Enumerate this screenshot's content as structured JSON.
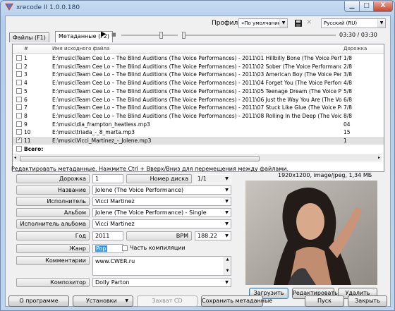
{
  "window": {
    "title": "xrecode II 1.0.0.180",
    "minimize_glyph": "▁",
    "maximize_glyph": "□",
    "close_glyph": "X"
  },
  "toolbar": {
    "profile_label": "Профиль",
    "profile_value": "«По умолчанию»",
    "save_icon": "floppy-disk-icon",
    "delete_icon": "close-x-icon",
    "language_value": "Русский (RU)",
    "tab_files": "Файлы (F1)",
    "tab_metadata": "Метаданные (F2)",
    "play_glyph": "▶",
    "stop_glyph": "■",
    "time": "03:30 / 03:30"
  },
  "list": {
    "col_number": "#",
    "col_filename": "Имя исходного файла",
    "col_track": "Дорожка",
    "rows": [
      {
        "num": "1",
        "file": "E:\\music\\Team Cee Lo – The Blind Auditions (The Voice Performances) - 2011\\01 Hillbilly Bone (The Voice Perform.m4a",
        "track": "1/8",
        "checked": false
      },
      {
        "num": "2",
        "file": "E:\\music\\Team Cee Lo – The Blind Auditions (The Voice Performances) - 2011\\02 Sober (The Voice Performance).m4a",
        "track": "2/8",
        "checked": false
      },
      {
        "num": "3",
        "file": "E:\\music\\Team Cee Lo – The Blind Auditions (The Voice Performances) - 2011\\03 American Boy (The Voice Performanc.m4a",
        "track": "3/8",
        "checked": false
      },
      {
        "num": "4",
        "file": "E:\\music\\Team Cee Lo – The Blind Auditions (The Voice Performances) - 2011\\04 Forget You (The Voice Performance).m4a",
        "track": "4/8",
        "checked": false
      },
      {
        "num": "5",
        "file": "E:\\music\\Team Cee Lo – The Blind Auditions (The Voice Performances) - 2011\\05 Teenage Dream (The Voice Performa.m4a",
        "track": "5/8",
        "checked": false
      },
      {
        "num": "6",
        "file": "E:\\music\\Team Cee Lo – The Blind Auditions (The Voice Performances) - 2011\\06 Just the Way You Are (The Voice Pe.m4a",
        "track": "6/8",
        "checked": false
      },
      {
        "num": "7",
        "file": "E:\\music\\Team Cee Lo – The Blind Auditions (The Voice Performances) - 2011\\07 Stuck Like Glue (The Voice Perfor.m4a",
        "track": "7/8",
        "checked": false
      },
      {
        "num": "8",
        "file": "E:\\music\\Team Cee Lo – The Blind Auditions (The Voice Performances) - 2011\\08 Rolling In the Deep (The Voice Pe.m4a",
        "track": "8/8",
        "checked": false
      },
      {
        "num": "9",
        "file": "E:\\music\\dia_frampton_heatless.mp3",
        "track": "04",
        "checked": false
      },
      {
        "num": "10",
        "file": "E:\\music\\triada_-_8_marta.mp3",
        "track": "15",
        "checked": false
      },
      {
        "num": "11",
        "file": "E:\\music\\Vicci_Martinez_-_Jolene.mp3",
        "track": "1",
        "checked": true
      }
    ],
    "total_label": "Всего:"
  },
  "editor": {
    "hint": "Редактировать метаданные. Нажмите Ctrl + Вверх/Вниз для перемещения между файлами.",
    "track_label": "Дорожка",
    "track_value": "1",
    "disc_label": "Номер диска",
    "disc_value": "1/1",
    "title_label": "Название",
    "title_value": "Jolene (The Voice Performance)",
    "artist_label": "Исполнитель",
    "artist_value": "Vicci Martinez",
    "album_label": "Альбом",
    "album_value": "Jolene (The Voice Performance) - Single",
    "album_artist_label": "Исполнитель альбома",
    "album_artist_value": "Vicci Martinez",
    "year_label": "Год",
    "year_value": "2011",
    "bpm_label": "BPM",
    "bpm_value": "188.22",
    "genre_label": "Жанр",
    "genre_value": "Pop",
    "compilation_label": "Часть компиляции",
    "comments_label": "Комментарии",
    "comments_value": "www.CWER.ru",
    "composer_label": "Композитор",
    "composer_value": "Dolly Parton"
  },
  "cover": {
    "info": "1920x1200, image/jpeg, 1,34 МБ",
    "load_button": "Загрузить",
    "edit_button": "Редактировать",
    "delete_button": "Удалить"
  },
  "footer": {
    "about_button": "О программе",
    "settings_button": "Установки",
    "capture_cd_button": "Захват CD",
    "save_metadata_button": "Сохранить метаданные",
    "start_button": "Пуск",
    "close_button": "Закрыть"
  },
  "colors": {
    "accent_blue": "#3c7fb1",
    "genre_highlight": "#3399ff"
  }
}
